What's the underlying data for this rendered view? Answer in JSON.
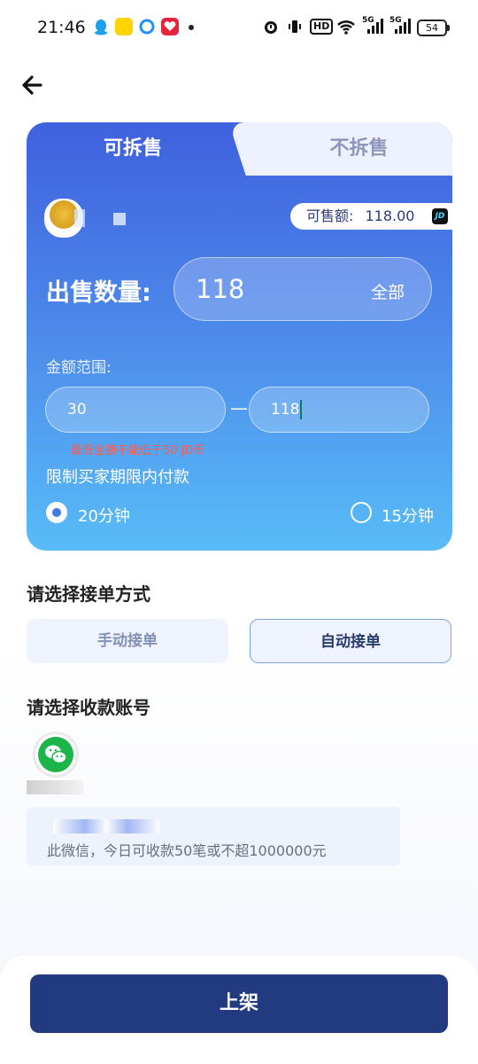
{
  "status_bar": {
    "time": "21:46",
    "hd_label": "HD",
    "net1": "5G",
    "net2": "5G",
    "battery": "54"
  },
  "nav": {
    "back_icon": "arrow-left-icon"
  },
  "tabs": [
    {
      "label": "可拆售",
      "selected": true
    },
    {
      "label": "不拆售",
      "selected": false
    }
  ],
  "seller": {
    "sellable_label": "可售额:",
    "sellable_amount": "118.00",
    "currency_icon": "JD"
  },
  "quantity": {
    "label": "出售数量:",
    "value": "118",
    "all_label": "全部"
  },
  "range": {
    "label": "金额范围:",
    "min": "30",
    "max": "118",
    "separator": "—",
    "error": "最低金额不能低于50 JD币"
  },
  "payment_limit": {
    "label": "限制买家期限内付款",
    "options": [
      {
        "label": "20分钟",
        "selected": true
      },
      {
        "label": "15分钟",
        "selected": false
      }
    ]
  },
  "order_mode": {
    "title": "请选择接单方式",
    "manual_label": "手动接单",
    "auto_label": "自动接单",
    "selected": "自动接单"
  },
  "account": {
    "title": "请选择收款账号",
    "icon": "wechat-icon",
    "note": "此微信，今日可收款50笔或不超1000000元"
  },
  "submit_label": "上架",
  "colors": {
    "primary": "#223a80",
    "card_top": "#3f61dd",
    "card_bottom": "#58bcf7",
    "error": "#ff5a4e",
    "wechat": "#1bb54a"
  }
}
